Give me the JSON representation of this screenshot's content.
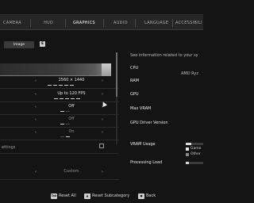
{
  "tabs": [
    {
      "label": "CAMERA",
      "active": false
    },
    {
      "label": "HUD",
      "active": false
    },
    {
      "label": "GRAPHICS",
      "active": true
    },
    {
      "label": "AUDIO",
      "active": false
    },
    {
      "label": "LANGUAGE",
      "active": false
    },
    {
      "label": "ACCESSIBILI",
      "active": false
    }
  ],
  "subtab": {
    "label": "Image",
    "key_hint": "E"
  },
  "settings": [
    {
      "name": "",
      "value": "2560 × 1440",
      "dim": false,
      "pips_on": 5
    },
    {
      "name": "",
      "value": "Up to 120 FPS",
      "dim": false,
      "pips_on": 5
    },
    {
      "name": "",
      "value": "Off",
      "dim": false,
      "pips_on": 1
    },
    {
      "name": "",
      "value": "Off",
      "dim": true,
      "pips_on": 1
    },
    {
      "name": "",
      "value": "On",
      "dim": true,
      "pips_on": 5
    }
  ],
  "link_row": {
    "name": "ettings"
  },
  "preset_row": {
    "value": "Custom"
  },
  "info": {
    "header": "See information related to your sy",
    "labels": [
      "CPU",
      "RAM",
      "GPU",
      "Max VRAM",
      "GPU Driver Version"
    ],
    "cpu_value": "AMD Ryz",
    "vram_usage_label": "VRAM Usage",
    "processing_load_label": "Processing Load",
    "vram_usage_level": 0.3,
    "processing_load_level": 0.2,
    "legend": [
      {
        "label": "Game",
        "color": "#e6e6e6"
      },
      {
        "label": "Other",
        "color": "#8a8a8a"
      }
    ]
  },
  "footer": [
    {
      "key": "Tab",
      "label": "Reset All"
    },
    {
      "key": "▲",
      "label": "Reset Subcategory"
    },
    {
      "key": "●",
      "label": "Back"
    }
  ],
  "colors": {
    "background": "#141414",
    "tabbar": "#262626",
    "accent": "#ffffff"
  }
}
